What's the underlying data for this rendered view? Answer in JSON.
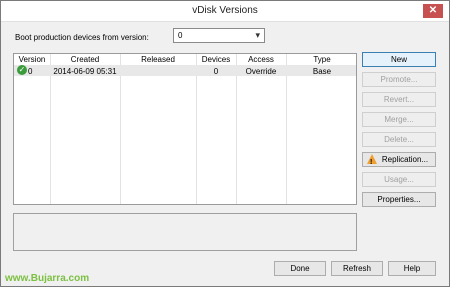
{
  "window": {
    "title": "vDisk Versions",
    "close_glyph": "✕"
  },
  "boot": {
    "label": "Boot production devices from version:",
    "selected": "0"
  },
  "grid": {
    "columns": [
      "Version",
      "Created",
      "Released",
      "Devices",
      "Access",
      "Type"
    ],
    "rows": [
      {
        "version": "0",
        "created": "2014-06-09 05:31",
        "released": "",
        "devices": "0",
        "access": "Override",
        "type": "Base",
        "status_icon": "check-icon"
      }
    ]
  },
  "buttons": {
    "new": "New",
    "promote": "Promote...",
    "revert": "Revert...",
    "merge": "Merge...",
    "delete": "Delete...",
    "replication": "Replication...",
    "usage": "Usage...",
    "properties": "Properties...",
    "done": "Done",
    "refresh": "Refresh",
    "help": "Help"
  },
  "watermark": "www.Bujarra.com"
}
